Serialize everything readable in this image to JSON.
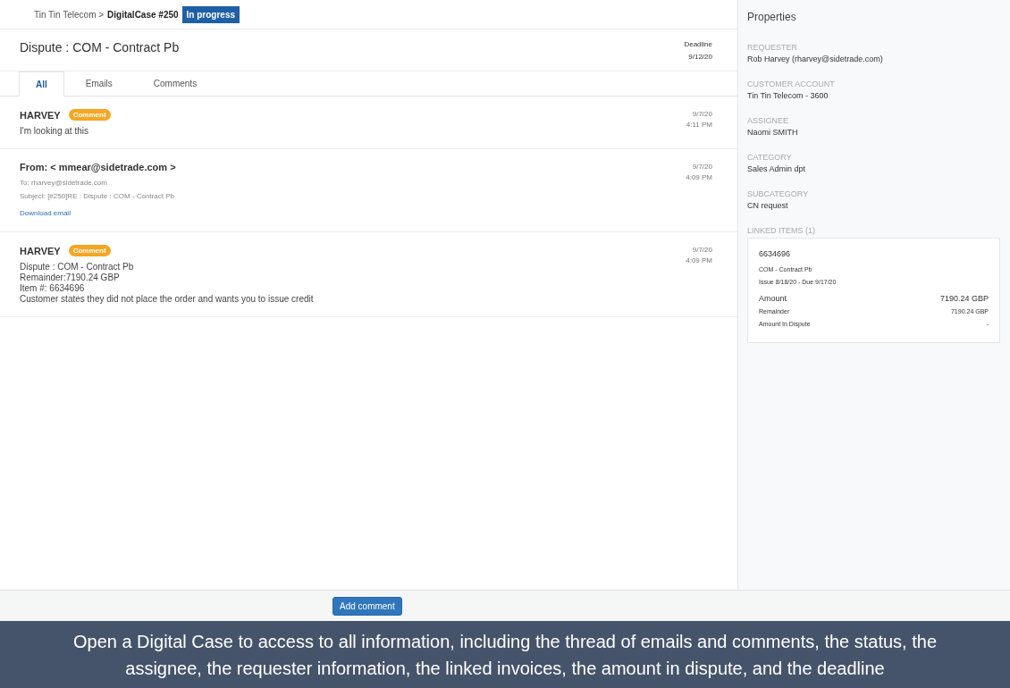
{
  "breadcrumb": {
    "parent": "Tin Tin Telecom >",
    "current": "DigitalCase #250",
    "status": "In progress"
  },
  "case": {
    "title": "Dispute : COM - Contract Pb",
    "deadline_label": "Deadline",
    "deadline": "9/12/20"
  },
  "tabs": [
    {
      "label": "All",
      "selected": true
    },
    {
      "label": "Emails",
      "selected": false
    },
    {
      "label": "Comments",
      "selected": false
    }
  ],
  "thread": [
    {
      "kind": "comment",
      "author": "HARVEY",
      "badge": "Comment",
      "lines": [
        "I'm looking at this"
      ],
      "date": "9/7/20",
      "time": "4:11 PM"
    },
    {
      "kind": "email",
      "from": "From: < mmear@sidetrade.com >",
      "to": "To: rharvey@sidetrade.com",
      "subject": "Subject: [#250]RE : Dispute : COM - Contract Pb",
      "link": "Download email",
      "date": "9/7/20",
      "time": "4:09 PM"
    },
    {
      "kind": "comment",
      "author": "HARVEY",
      "badge": "Comment",
      "lines": [
        "Dispute : COM - Contract Pb",
        "Remainder:7190.24 GBP",
        "Item #: 6634696",
        "Customer states they did not place the order and wants you to issue credit"
      ],
      "date": "9/7/20",
      "time": "4:09 PM"
    }
  ],
  "properties": {
    "title": "Properties",
    "fields": [
      {
        "label": "REQUESTER",
        "value": "Rob Harvey (rharvey@sidetrade.com)"
      },
      {
        "label": "CUSTOMER ACCOUNT",
        "value": "Tin Tin Telecom - 3600"
      },
      {
        "label": "ASSIGNEE",
        "value": "Naomi SMITH"
      },
      {
        "label": "CATEGORY",
        "value": "Sales Admin dpt"
      },
      {
        "label": "SUBCATEGORY",
        "value": "CN request"
      }
    ],
    "linked_label": "LINKED ITEMS (1)",
    "linked_items": [
      {
        "number": "6634696",
        "description": "COM - Contract Pb",
        "dates": "Issue 8/18/20 - Due 9/17/20",
        "amounts": [
          {
            "label": "Amount",
            "value": "7190.24 GBP"
          },
          {
            "label": "Remainder",
            "value": "7190.24 GBP"
          },
          {
            "label": "Amount In Dispute",
            "value": "-"
          }
        ]
      }
    ]
  },
  "footer": {
    "button": "Add comment"
  },
  "caption": "Open a Digital Case to access to all information, including the thread of emails and comments, the status, the assignee, the requester information, the linked invoices, the amount in dispute, and the deadline"
}
